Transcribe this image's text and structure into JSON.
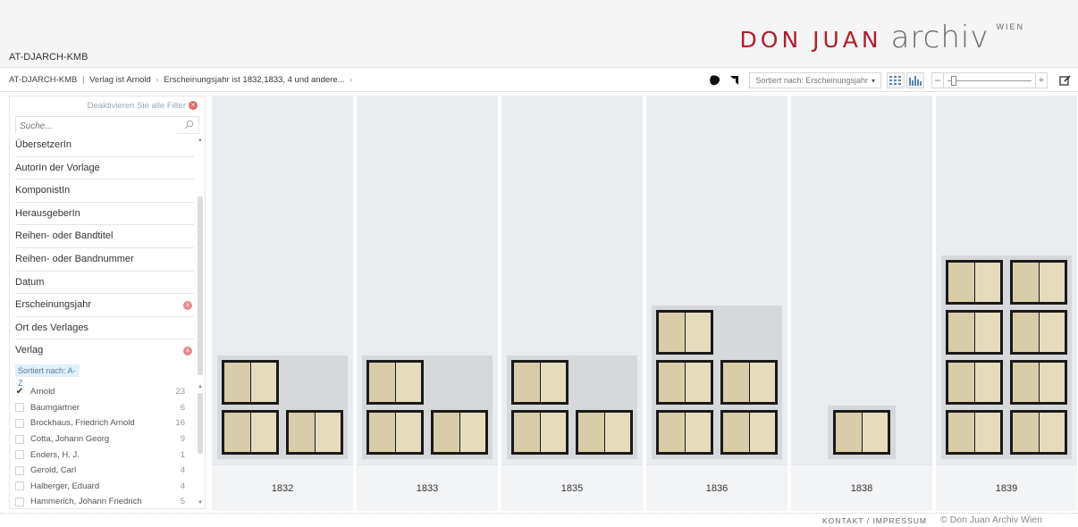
{
  "header": {
    "collection_code": "AT-DJARCH-KMB",
    "brand_part1": "DON JUAN",
    "brand_part2": "archiv",
    "brand_part3": "WIEN"
  },
  "breadcrumb": {
    "root": "AT-DJARCH-KMB",
    "filter1_prefix": "Verlag ist",
    "filter1_value": "Arnold",
    "filter2_prefix": "Erscheinungsjahr ist",
    "filter2_value": "1832,1833, 4 und andere...",
    "arrow": "›"
  },
  "toolbar": {
    "sort_label": "Sortiert nach: Erscheinungsjahr",
    "zoom_minus": "–",
    "zoom_plus": "+",
    "zoom_level": 0.05,
    "icons": [
      "blob-icon",
      "crop-icon",
      "grid-view-icon",
      "bar-view-icon",
      "edit-icon"
    ]
  },
  "sidebar": {
    "deactivate_label": "Deaktivieren Sie alle Filter",
    "search_placeholder": "Suche...",
    "facets": [
      {
        "label": "ÜbersetzerIn",
        "active": false
      },
      {
        "label": "AutorIn der Vorlage",
        "active": false
      },
      {
        "label": "KomponistIn",
        "active": false
      },
      {
        "label": "HerausgeberIn",
        "active": false
      },
      {
        "label": "Reihen- oder Bandtitel",
        "active": false
      },
      {
        "label": "Reihen- oder Bandnummer",
        "active": false
      },
      {
        "label": "Datum",
        "active": false
      },
      {
        "label": "Erscheinungsjahr",
        "active": true
      },
      {
        "label": "Ort des Verlages",
        "active": false
      },
      {
        "label": "Verlag",
        "active": true
      }
    ],
    "verlag_sort_note": "Sortiert nach: A-Z",
    "verlag_values": [
      {
        "name": "Arnold",
        "count": "23",
        "checked": true
      },
      {
        "name": "Baumgartner",
        "count": "6",
        "checked": false
      },
      {
        "name": "Brockhaus, Friedrich Arnold",
        "count": "16",
        "checked": false
      },
      {
        "name": "Cotta, Johann Georg",
        "count": "9",
        "checked": false
      },
      {
        "name": "Enders, H. J.",
        "count": "1",
        "checked": false
      },
      {
        "name": "Gerold, Carl",
        "count": "4",
        "checked": false
      },
      {
        "name": "Halberger, Eduard",
        "count": "4",
        "checked": false
      },
      {
        "name": "Hammerich, Johann Friedrich",
        "count": "5",
        "checked": false
      }
    ]
  },
  "columns": [
    {
      "year": "1832",
      "items": 3
    },
    {
      "year": "1833",
      "items": 3
    },
    {
      "year": "1835",
      "items": 3
    },
    {
      "year": "1836",
      "items": 5
    },
    {
      "year": "1838",
      "items": 1
    },
    {
      "year": "1839",
      "items": 8
    }
  ],
  "footer": {
    "kontakt": "KONTAKT / IMPRESSUM",
    "copyright": "© Don Juan Archiv Wien"
  }
}
